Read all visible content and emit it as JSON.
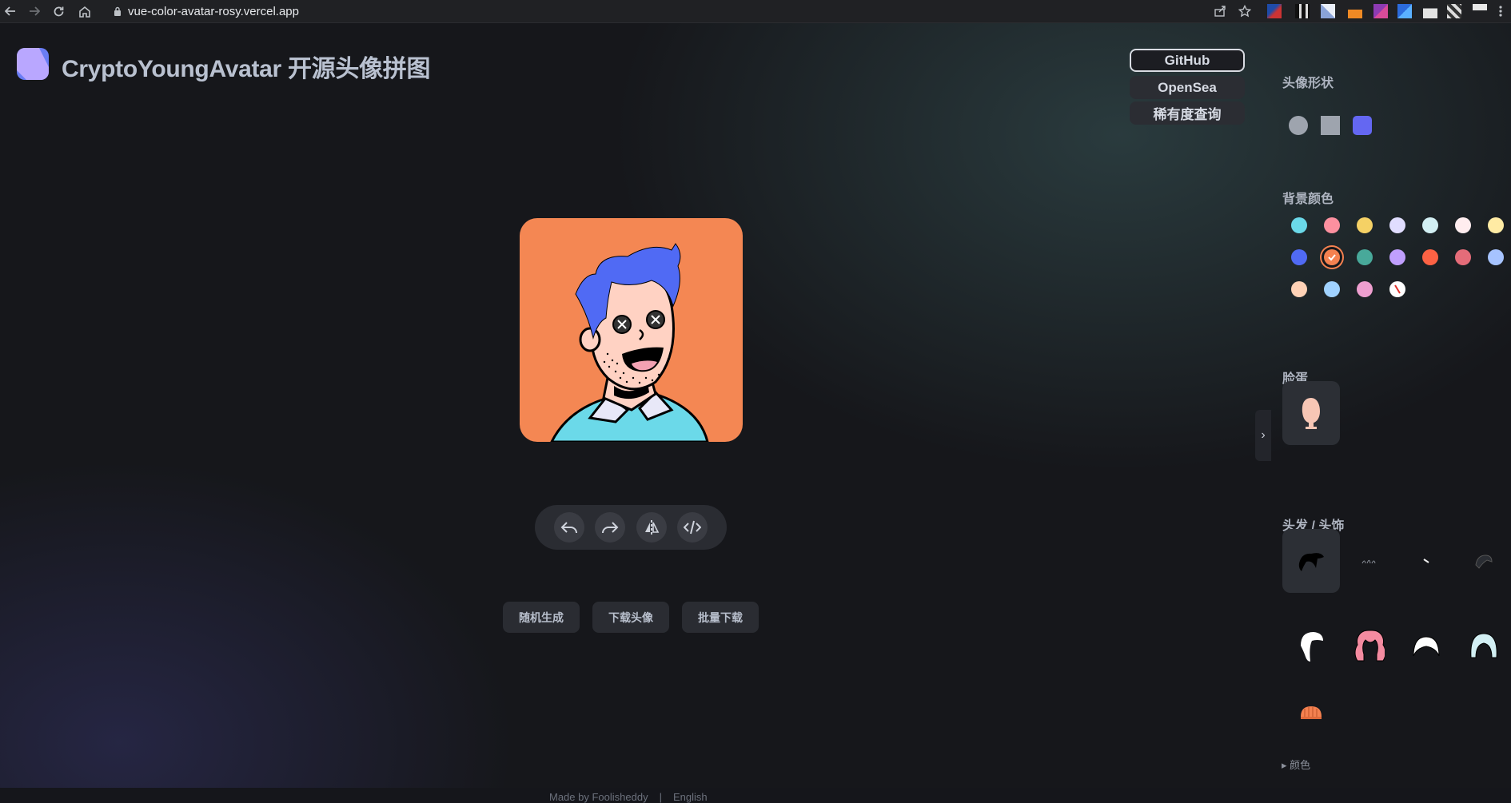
{
  "browser": {
    "url": "vue-color-avatar-rosy.vercel.app",
    "icons": [
      "back-icon",
      "forward-icon",
      "reload-icon",
      "home-icon",
      "lock-icon",
      "share-icon",
      "bookmark-star-icon",
      "extensions-icon",
      "menu-dots-icon"
    ]
  },
  "header": {
    "title": "CryptoYoungAvatar 开源头像拼图"
  },
  "top_links": {
    "github": "GitHub",
    "opensea": "OpenSea",
    "rarity": "稀有度查询"
  },
  "actions": {
    "icons": [
      "undo-icon",
      "redo-icon",
      "flip-icon",
      "code-icon"
    ]
  },
  "buttons": {
    "random": "随机生成",
    "download": "下载头像",
    "batch": "批量下载"
  },
  "footer": {
    "made_by": "Made by Foolisheddy",
    "divider": "|",
    "language": "English"
  },
  "panel": {
    "shape_title": "头像形状",
    "shapes": [
      "circle",
      "square",
      "squircle"
    ],
    "shape_colors": [
      "#9ea4ae",
      "#9ea4ae",
      "#6467f2"
    ],
    "bg_title": "背景颜色",
    "bg_colors": [
      "#6bd9e9",
      "#fc909f",
      "#f5d165",
      "#e0ddff",
      "#d2eff3",
      "#ffedef",
      "#ffeba4",
      "#506af4",
      "#f48150",
      "#48a99a",
      "#c09ffe",
      "#fd6244",
      "#e56c79",
      "#a6c3ff",
      "#ffd2b6",
      "#a0d2ff",
      "#ee9fcf",
      "#ffffff"
    ],
    "bg_selected": "#f48150",
    "face_title": "脸蛋",
    "hair_title": "头发 / 头饰",
    "color_toggle": "颜色",
    "accent": "#6467f2"
  }
}
